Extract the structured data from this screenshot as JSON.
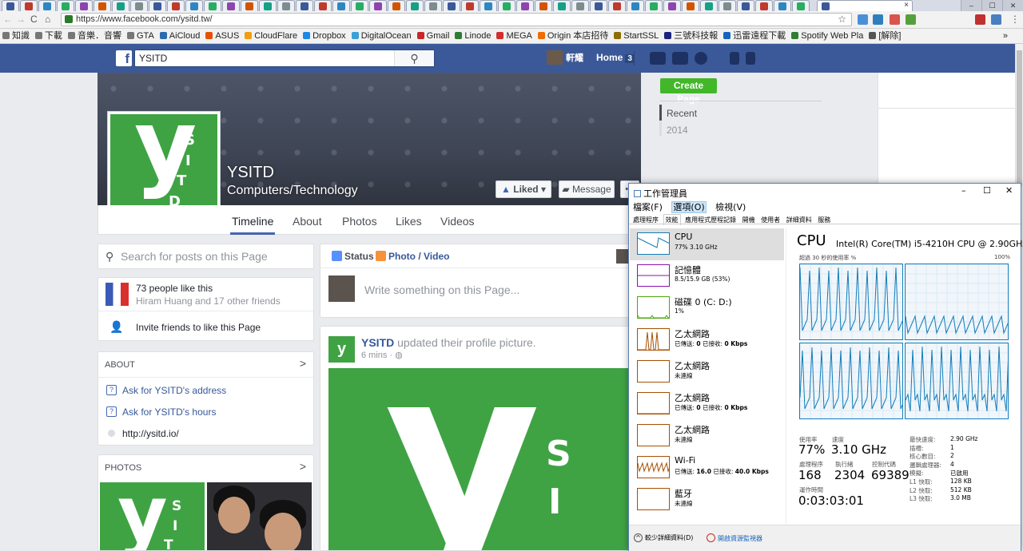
{
  "browser": {
    "active_tab_close": "×",
    "url": "https://www.facebook.com/ysitd.tw/",
    "bookmarks": [
      "知識",
      "下載",
      "音樂．音響",
      "GTA",
      "AiCloud",
      "ASUS",
      "CloudFlare",
      "Dropbox",
      "DigitalOcean",
      "Gmail",
      "Linode",
      "MEGA",
      "Origin 本店招待",
      "StartSSL",
      "三號科技報",
      "迅雷遠程下載",
      "Spotify Web Pla",
      "[解除]"
    ],
    "bookmarks_more": "»",
    "colors": {
      "chrome_bg": "#f2f2f2",
      "tabstrip": "#d6dbe6"
    }
  },
  "facebook": {
    "logo_letter": "f",
    "search_value": "YSITD",
    "search_icon": "search-icon",
    "user_name": "軒耀",
    "home_label": "Home",
    "home_count": "3",
    "page": {
      "name": "YSITD",
      "category": "Computers/Technology",
      "liked_label": "Liked ▾",
      "message_label": "Message",
      "more_label": "•••"
    },
    "tabs": [
      "Timeline",
      "About",
      "Photos",
      "Likes",
      "Videos"
    ],
    "left": {
      "search_placeholder": "Search for posts on this Page",
      "likes_count": "73 people like this",
      "likes_friends": "Hiram Huang and 17 other friends",
      "invite_label": "Invite friends to like this Page",
      "about_title": "ABOUT",
      "about_items": [
        "Ask for YSITD's address",
        "Ask for YSITD's hours",
        "http://ysitd.io/"
      ],
      "photos_title": "PHOTOS"
    },
    "composer": {
      "status_label": "Status",
      "photo_label": "Photo / Video",
      "placeholder": "Write something on this Page..."
    },
    "post": {
      "author": "YSITD",
      "action": "updated their profile picture.",
      "time": "6 mins · ◍"
    },
    "logo": {
      "y": "y",
      "s": "S",
      "i": "I",
      "t": "T",
      "d": "D"
    },
    "right": {
      "create_page": "Create Page",
      "recent": "Recent",
      "year": "2014"
    },
    "colors": {
      "blue_bar": "#3b5998",
      "brand_green": "#3fa344",
      "create_green": "#42b72a"
    }
  },
  "taskmanager": {
    "title": "工作管理員",
    "controls": [
      "–",
      "☐",
      "✕"
    ],
    "menu": [
      "檔案(F)",
      "選項(O)",
      "檢視(V)"
    ],
    "tabs": [
      "處理程序",
      "效能",
      "應用程式歷程記錄",
      "開機",
      "使用者",
      "詳細資料",
      "服務"
    ],
    "resources": [
      {
        "name": "CPU",
        "sub": "77% 3.10 GHz",
        "color": "#117dbb"
      },
      {
        "name": "記憶體",
        "sub": "8.5/15.9 GB (53%)",
        "color": "#8b12ae"
      },
      {
        "name": "磁碟 0 (C: D:)",
        "sub": "1%",
        "color": "#4da60c"
      },
      {
        "name": "乙太網路",
        "sub_pre": "已傳送: ",
        "sub_a": "0",
        "sub_mid": " 已接收: ",
        "sub_b": "0 Kbps",
        "color": "#a74f01"
      },
      {
        "name": "乙太網路",
        "sub": "未連線",
        "color": "#a74f01"
      },
      {
        "name": "乙太網路",
        "sub_pre": "已傳送: ",
        "sub_a": "0",
        "sub_mid": " 已接收: ",
        "sub_b": "0 Kbps",
        "color": "#a74f01"
      },
      {
        "name": "乙太網路",
        "sub": "未連線",
        "color": "#a74f01"
      },
      {
        "name": "Wi-Fi",
        "sub_pre": "已傳送: ",
        "sub_a": "16.0",
        "sub_mid": " 已接收: ",
        "sub_b": "40.0 Kbps",
        "color": "#a74f01"
      },
      {
        "name": "藍牙",
        "sub": "未連線",
        "color": "#a74f01"
      }
    ],
    "cpu": {
      "heading": "CPU",
      "model": "Intel(R) Core(TM) i5-4210H CPU @ 2.90GHz",
      "graph_caption": "超過 30 秒的使用率 %",
      "graph_max": "100%",
      "utilization_label": "使用率",
      "utilization": "77%",
      "speed_label": "速度",
      "speed": "3.10 GHz",
      "processes_label": "處理程序",
      "processes": "168",
      "threads_label": "執行緒",
      "threads": "2304",
      "handles_label": "控制代碼",
      "handles": "69389",
      "uptime_label": "運作時間",
      "uptime": "0:03:03:01",
      "specs": [
        {
          "k": "最快速度:",
          "v": "2.90 GHz"
        },
        {
          "k": "插槽:",
          "v": "1"
        },
        {
          "k": "核心數目:",
          "v": "2"
        },
        {
          "k": "邏輯處理器:",
          "v": "4"
        },
        {
          "k": "模擬:",
          "v": "已啟用"
        },
        {
          "k": "L1 快取:",
          "v": "128 KB"
        },
        {
          "k": "L2 快取:",
          "v": "512 KB"
        },
        {
          "k": "L3 快取:",
          "v": "3.0 MB"
        }
      ]
    },
    "footer": {
      "fewer_details": "較少詳細資料(D)",
      "open_monitor": "開啟資源監視器"
    }
  }
}
